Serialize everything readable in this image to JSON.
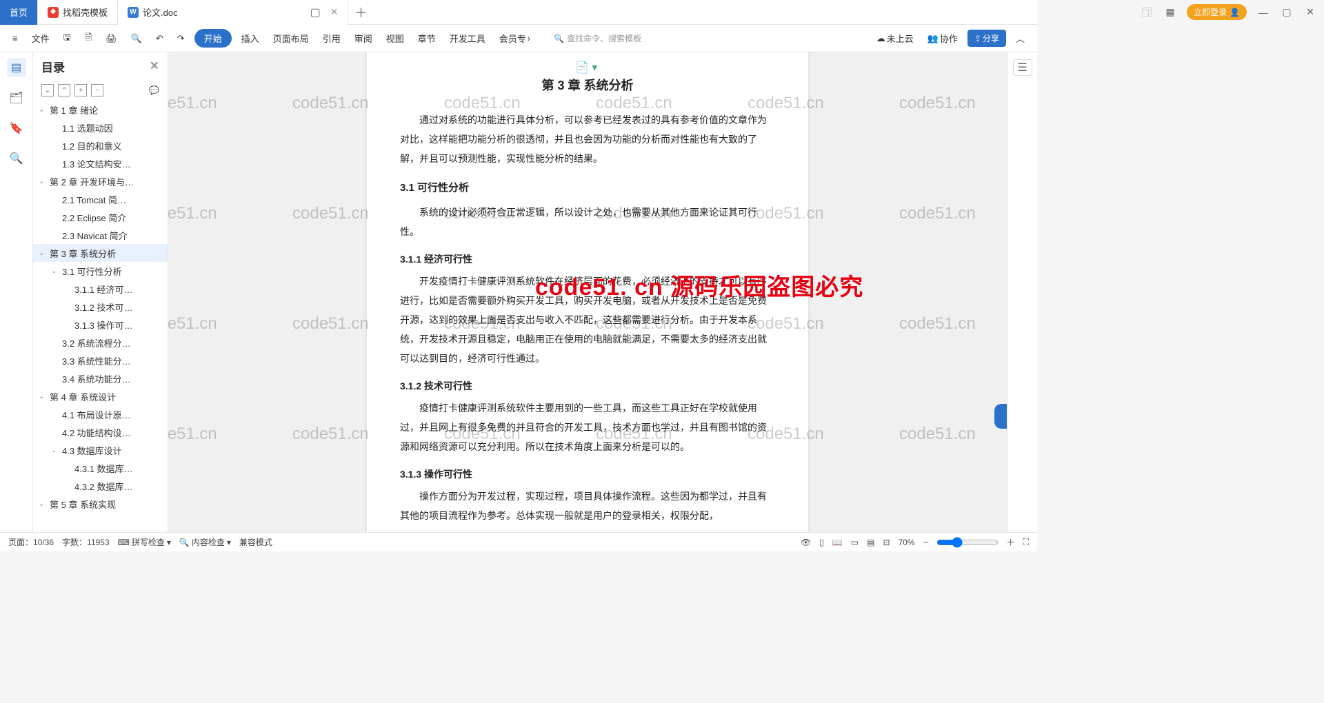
{
  "tabs": {
    "home": "首页",
    "template": "找稻壳模板",
    "doc": "论文.doc"
  },
  "login": "立即登录",
  "ribbon": {
    "file": "文件",
    "start": "开始",
    "insert": "插入",
    "layout": "页面布局",
    "ref": "引用",
    "review": "审阅",
    "view": "视图",
    "chapter": "章节",
    "devtools": "开发工具",
    "member": "会员专",
    "search": "查找命令、搜索模板",
    "cloud": "未上云",
    "coop": "协作",
    "share": "分享"
  },
  "outline": {
    "title": "目录",
    "items": [
      {
        "d": 1,
        "t": "第 1 章  绪论",
        "c": 1
      },
      {
        "d": 2,
        "t": "1.1  选题动因"
      },
      {
        "d": 2,
        "t": "1.2  目的和意义"
      },
      {
        "d": 2,
        "t": "1.3  论文结构安…"
      },
      {
        "d": 1,
        "t": "第 2 章  开发环境与…",
        "c": 1
      },
      {
        "d": 2,
        "t": "2.1  Tomcat  简…"
      },
      {
        "d": 2,
        "t": "2.2  Eclipse 简介"
      },
      {
        "d": 2,
        "t": "2.3  Navicat 简介"
      },
      {
        "d": 1,
        "t": "第 3 章  系统分析",
        "c": 1,
        "sel": 1
      },
      {
        "d": 2,
        "t": "3.1  可行性分析",
        "c": 1
      },
      {
        "d": 3,
        "t": "3.1.1  经济可…"
      },
      {
        "d": 3,
        "t": "3.1.2  技术可…"
      },
      {
        "d": 3,
        "t": "3.1.3  操作可…"
      },
      {
        "d": 2,
        "t": "3.2  系统流程分…"
      },
      {
        "d": 2,
        "t": "3.3  系统性能分…"
      },
      {
        "d": 2,
        "t": "3.4  系统功能分…"
      },
      {
        "d": 1,
        "t": "第 4 章  系统设计",
        "c": 1
      },
      {
        "d": 2,
        "t": "4.1  布局设计原…"
      },
      {
        "d": 2,
        "t": "4.2  功能结构设…"
      },
      {
        "d": 2,
        "t": "4.3 数据库设计",
        "c": 1
      },
      {
        "d": 3,
        "t": "4.3.1  数据库…"
      },
      {
        "d": 3,
        "t": "4.3.2  数据库…"
      },
      {
        "d": 1,
        "t": "第 5 章  系统实现",
        "c": 1
      }
    ]
  },
  "doc": {
    "h2": "第 3 章  系统分析",
    "p1": "通过对系统的功能进行具体分析，可以参考已经发表过的具有参考价值的文章作为对比，这样能把功能分析的很透彻，并且也会因为功能的分析而对性能也有大致的了解，并且可以预测性能，实现性能分析的结果。",
    "h31": "3.1  可行性分析",
    "p2": "系统的设计必须符合正常逻辑，所以设计之处，也需要从其他方面来论证其可行性。",
    "h41": "3.1.1  经济可行性",
    "p3": "开发疫情打卡健康评测系统软件在经济层面的花费，必须经济上的支持才可以有序进行，比如是否需要额外购买开发工具，购买开发电脑，或者从开发技术上是否是免费开源，达到的效果上面是否支出与收入不匹配，这些都需要进行分析。由于开发本系统，开发技术开源且稳定，电脑用正在使用的电脑就能满足，不需要太多的经济支出就可以达到目的，经济可行性通过。",
    "h42": "3.1.2  技术可行性",
    "p4": "疫情打卡健康评测系统软件主要用到的一些工具，而这些工具正好在学校就使用过，并且网上有很多免费的并且符合的开发工具，技术方面也学过，并且有图书馆的资源和网络资源可以充分利用。所以在技术角度上面来分析是可以的。",
    "h43": "3.1.3  操作可行性",
    "p5": "操作方面分为开发过程，实现过程，项目具体操作流程。这些因为都学过，并且有其他的项目流程作为参考。总体实现一般就是用户的登录相关，权限分配，"
  },
  "statusbar": {
    "page": "页面：10/36",
    "words": "字数：11953",
    "spell": "拼写检查",
    "content": "内容检查",
    "compat": "兼容模式",
    "zoom": "70%"
  },
  "watermark": "code51.cn",
  "watermark_red": "code51. cn   源码乐园盗图必究"
}
